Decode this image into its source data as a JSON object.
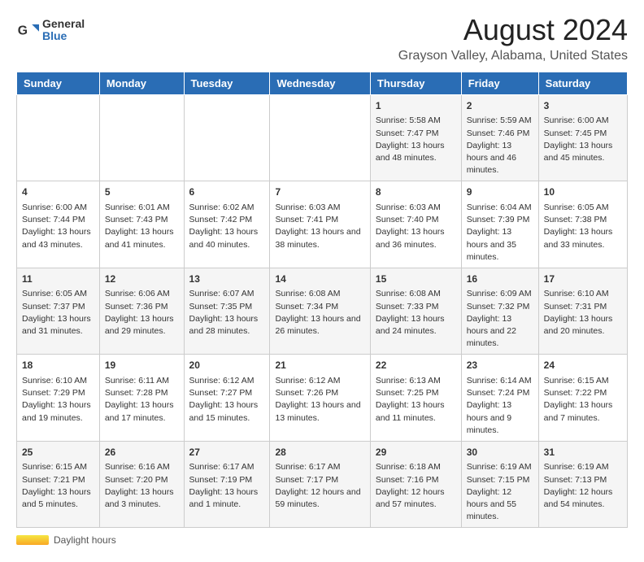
{
  "logo": {
    "general": "General",
    "blue": "Blue"
  },
  "title": "August 2024",
  "subtitle": "Grayson Valley, Alabama, United States",
  "days_of_week": [
    "Sunday",
    "Monday",
    "Tuesday",
    "Wednesday",
    "Thursday",
    "Friday",
    "Saturday"
  ],
  "footer": {
    "daylight_label": "Daylight hours"
  },
  "weeks": [
    [
      {
        "day": "",
        "info": ""
      },
      {
        "day": "",
        "info": ""
      },
      {
        "day": "",
        "info": ""
      },
      {
        "day": "",
        "info": ""
      },
      {
        "day": "1",
        "info": "Sunrise: 5:58 AM\nSunset: 7:47 PM\nDaylight: 13 hours\nand 48 minutes."
      },
      {
        "day": "2",
        "info": "Sunrise: 5:59 AM\nSunset: 7:46 PM\nDaylight: 13 hours\nand 46 minutes."
      },
      {
        "day": "3",
        "info": "Sunrise: 6:00 AM\nSunset: 7:45 PM\nDaylight: 13 hours\nand 45 minutes."
      }
    ],
    [
      {
        "day": "4",
        "info": "Sunrise: 6:00 AM\nSunset: 7:44 PM\nDaylight: 13 hours\nand 43 minutes."
      },
      {
        "day": "5",
        "info": "Sunrise: 6:01 AM\nSunset: 7:43 PM\nDaylight: 13 hours\nand 41 minutes."
      },
      {
        "day": "6",
        "info": "Sunrise: 6:02 AM\nSunset: 7:42 PM\nDaylight: 13 hours\nand 40 minutes."
      },
      {
        "day": "7",
        "info": "Sunrise: 6:03 AM\nSunset: 7:41 PM\nDaylight: 13 hours\nand 38 minutes."
      },
      {
        "day": "8",
        "info": "Sunrise: 6:03 AM\nSunset: 7:40 PM\nDaylight: 13 hours\nand 36 minutes."
      },
      {
        "day": "9",
        "info": "Sunrise: 6:04 AM\nSunset: 7:39 PM\nDaylight: 13 hours\nand 35 minutes."
      },
      {
        "day": "10",
        "info": "Sunrise: 6:05 AM\nSunset: 7:38 PM\nDaylight: 13 hours\nand 33 minutes."
      }
    ],
    [
      {
        "day": "11",
        "info": "Sunrise: 6:05 AM\nSunset: 7:37 PM\nDaylight: 13 hours\nand 31 minutes."
      },
      {
        "day": "12",
        "info": "Sunrise: 6:06 AM\nSunset: 7:36 PM\nDaylight: 13 hours\nand 29 minutes."
      },
      {
        "day": "13",
        "info": "Sunrise: 6:07 AM\nSunset: 7:35 PM\nDaylight: 13 hours\nand 28 minutes."
      },
      {
        "day": "14",
        "info": "Sunrise: 6:08 AM\nSunset: 7:34 PM\nDaylight: 13 hours\nand 26 minutes."
      },
      {
        "day": "15",
        "info": "Sunrise: 6:08 AM\nSunset: 7:33 PM\nDaylight: 13 hours\nand 24 minutes."
      },
      {
        "day": "16",
        "info": "Sunrise: 6:09 AM\nSunset: 7:32 PM\nDaylight: 13 hours\nand 22 minutes."
      },
      {
        "day": "17",
        "info": "Sunrise: 6:10 AM\nSunset: 7:31 PM\nDaylight: 13 hours\nand 20 minutes."
      }
    ],
    [
      {
        "day": "18",
        "info": "Sunrise: 6:10 AM\nSunset: 7:29 PM\nDaylight: 13 hours\nand 19 minutes."
      },
      {
        "day": "19",
        "info": "Sunrise: 6:11 AM\nSunset: 7:28 PM\nDaylight: 13 hours\nand 17 minutes."
      },
      {
        "day": "20",
        "info": "Sunrise: 6:12 AM\nSunset: 7:27 PM\nDaylight: 13 hours\nand 15 minutes."
      },
      {
        "day": "21",
        "info": "Sunrise: 6:12 AM\nSunset: 7:26 PM\nDaylight: 13 hours\nand 13 minutes."
      },
      {
        "day": "22",
        "info": "Sunrise: 6:13 AM\nSunset: 7:25 PM\nDaylight: 13 hours\nand 11 minutes."
      },
      {
        "day": "23",
        "info": "Sunrise: 6:14 AM\nSunset: 7:24 PM\nDaylight: 13 hours\nand 9 minutes."
      },
      {
        "day": "24",
        "info": "Sunrise: 6:15 AM\nSunset: 7:22 PM\nDaylight: 13 hours\nand 7 minutes."
      }
    ],
    [
      {
        "day": "25",
        "info": "Sunrise: 6:15 AM\nSunset: 7:21 PM\nDaylight: 13 hours\nand 5 minutes."
      },
      {
        "day": "26",
        "info": "Sunrise: 6:16 AM\nSunset: 7:20 PM\nDaylight: 13 hours\nand 3 minutes."
      },
      {
        "day": "27",
        "info": "Sunrise: 6:17 AM\nSunset: 7:19 PM\nDaylight: 13 hours\nand 1 minute."
      },
      {
        "day": "28",
        "info": "Sunrise: 6:17 AM\nSunset: 7:17 PM\nDaylight: 12 hours\nand 59 minutes."
      },
      {
        "day": "29",
        "info": "Sunrise: 6:18 AM\nSunset: 7:16 PM\nDaylight: 12 hours\nand 57 minutes."
      },
      {
        "day": "30",
        "info": "Sunrise: 6:19 AM\nSunset: 7:15 PM\nDaylight: 12 hours\nand 55 minutes."
      },
      {
        "day": "31",
        "info": "Sunrise: 6:19 AM\nSunset: 7:13 PM\nDaylight: 12 hours\nand 54 minutes."
      }
    ]
  ]
}
